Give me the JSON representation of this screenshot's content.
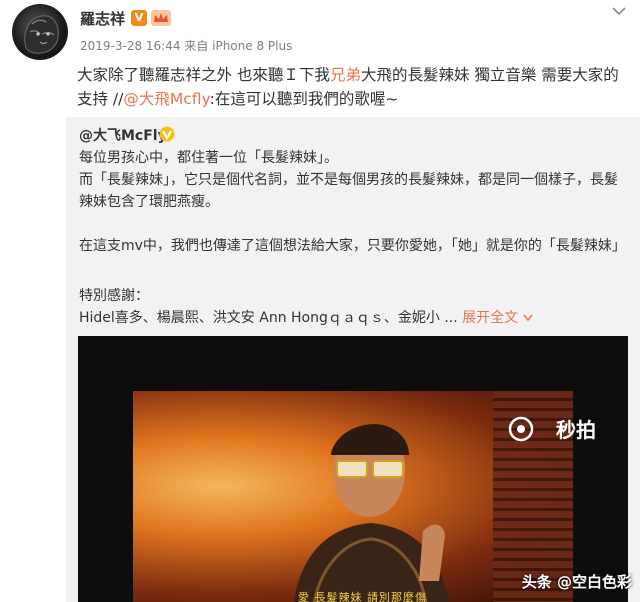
{
  "post": {
    "username": "羅志祥",
    "vip_badge": "V",
    "meta": "2019-3-28 16:44 来自 iPhone 8 Plus",
    "text_part1": "大家除了聽羅志祥之外 也來聽Ｉ下我",
    "text_highlight1": "兄弟",
    "text_part2": "大飛的長髮辣妹 獨立音樂 需要大家的支持 //",
    "text_mention": "@大飛Mcfly",
    "text_part3": ":在這可以聽到我們的歌喔~"
  },
  "repost": {
    "author": "@大飞McFly",
    "lines": [
      "每位男孩心中，都住著一位「長髮辣妹」。",
      "而「長髮辣妹」，它只是個代名詞，並不是每個男孩的長髮辣妹，都是同一個樣子，長髮辣妹包含了環肥燕瘦。",
      "在這支mv中，我們也傳達了這個想法給大家，只要你愛她，「她」就是你的「長髮辣妹」",
      "特別感謝：",
      "Hidel喜多、楊晨熙、洪文安 Ann Hongｑａｑｓ、金妮小 ..."
    ],
    "expand": "展开全文",
    "video": {
      "brand": "秒拍",
      "subtitle": "愛 長髮辣妹 請別那麼傷"
    }
  },
  "watermark": "头条 @空白色彩",
  "colors": {
    "accent": "#eb7350",
    "badge": "#f08a1c",
    "repost_bg": "#f2f2f5"
  }
}
